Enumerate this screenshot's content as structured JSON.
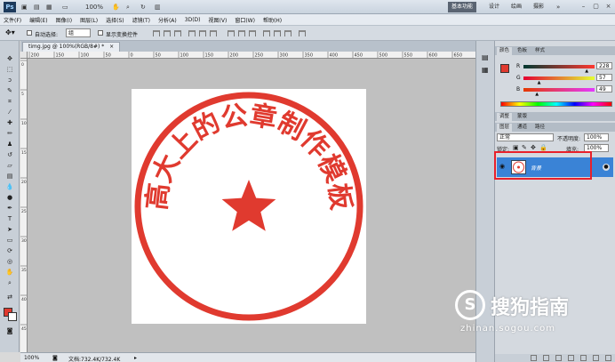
{
  "titlebar": {
    "logo": "Ps",
    "zoom": "100%",
    "workspaces": [
      "基本功能",
      "设计",
      "绘画",
      "摄影"
    ],
    "active_workspace": 0,
    "window_controls": [
      "minimize-icon",
      "restore-icon",
      "close-icon"
    ]
  },
  "menu": [
    "文件(F)",
    "编辑(E)",
    "图像(I)",
    "图层(L)",
    "选择(S)",
    "滤镜(T)",
    "分析(A)",
    "3D(D)",
    "视图(V)",
    "窗口(W)",
    "帮助(H)"
  ],
  "options": {
    "auto_select_label": "自动选择:",
    "auto_select_value": "组",
    "show_transform_label": "显示变换控件"
  },
  "document": {
    "tab_label": "timg.jpg @ 100%(RGB/8#) *",
    "close_glyph": "×",
    "zoom": "100%",
    "doc_info": "文档:732.4K/732.4K"
  },
  "rulers": {
    "h_ticks": [
      "200",
      "150",
      "100",
      "50",
      "0",
      "50",
      "100",
      "150",
      "200",
      "250",
      "300",
      "350",
      "400",
      "450",
      "500",
      "550",
      "600",
      "650"
    ],
    "v_ticks": [
      "0",
      "5",
      "10",
      "15",
      "20",
      "25",
      "30",
      "35",
      "40",
      "45"
    ]
  },
  "seal": {
    "text": "高大上的公章制作模板",
    "color": "#e03a2f"
  },
  "color_panel": {
    "tabs": [
      "颜色",
      "色板",
      "样式"
    ],
    "channels": [
      {
        "label": "R",
        "value": "228",
        "fraction": 0.89
      },
      {
        "label": "G",
        "value": "57",
        "fraction": 0.22
      },
      {
        "label": "B",
        "value": "49",
        "fraction": 0.19
      }
    ],
    "foreground": "#e03a2f"
  },
  "adjust_panel": {
    "tabs": [
      "调整",
      "蒙版"
    ]
  },
  "layers_panel": {
    "tabs": [
      "图层",
      "通道",
      "路径"
    ],
    "blend_mode": "正常",
    "opacity_label": "不透明度:",
    "opacity_value": "100%",
    "lock_label": "锁定:",
    "fill_label": "填充:",
    "fill_value": "100%",
    "layer_name": "背景",
    "selection_color": "#3a83d6",
    "highlight_color": "#e8202a"
  },
  "watermark": {
    "glyph": "S",
    "text": "搜狗指南",
    "url": "zhinan.sogou.com"
  }
}
